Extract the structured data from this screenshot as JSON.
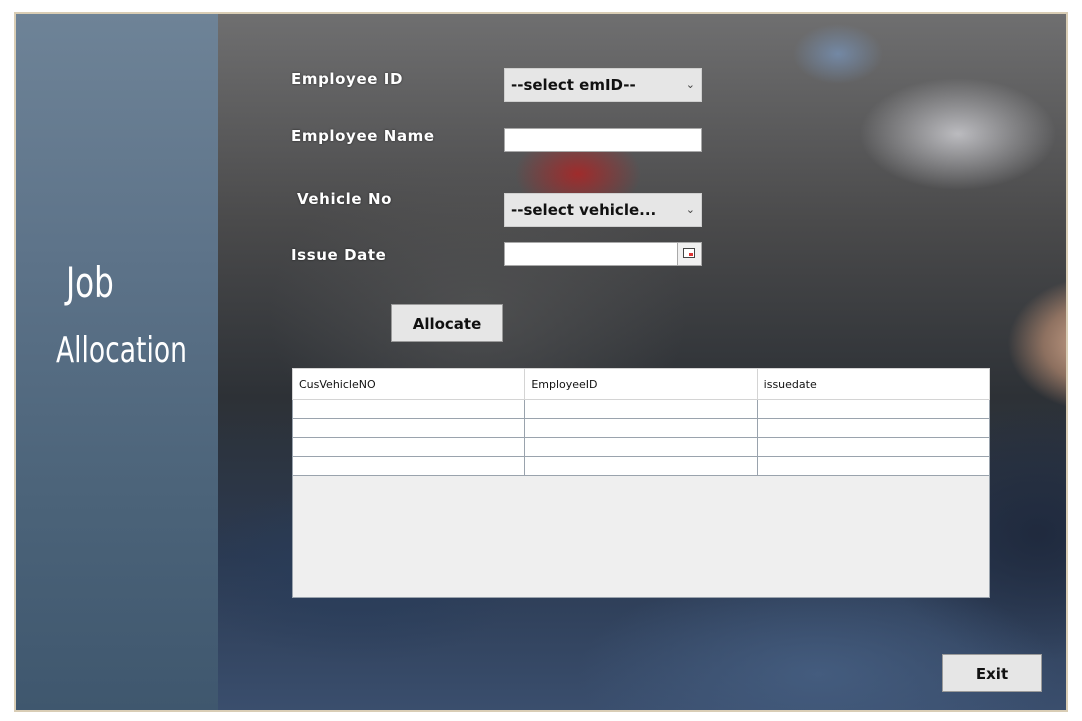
{
  "sidebar": {
    "title_line1": "Job",
    "title_line2": "Allocation"
  },
  "form": {
    "employee_id_label": "Employee ID",
    "employee_id_value": "--select emID--",
    "employee_name_label": "Employee Name",
    "employee_name_value": "",
    "vehicle_no_label": "Vehicle No",
    "vehicle_no_value": "--select vehicle...",
    "issue_date_label": "Issue Date",
    "issue_date_value": ""
  },
  "buttons": {
    "allocate_label": "Allocate",
    "exit_label": "Exit"
  },
  "table": {
    "columns": [
      "CusVehicleNO",
      "EmployeeID",
      "issuedate"
    ],
    "rows": [
      [
        "",
        "",
        ""
      ],
      [
        "",
        "",
        ""
      ],
      [
        "",
        "",
        ""
      ],
      [
        "",
        "",
        ""
      ]
    ]
  },
  "icons": {
    "dropdown": "chevron-down-icon",
    "date_picker": "calendar-icon"
  }
}
